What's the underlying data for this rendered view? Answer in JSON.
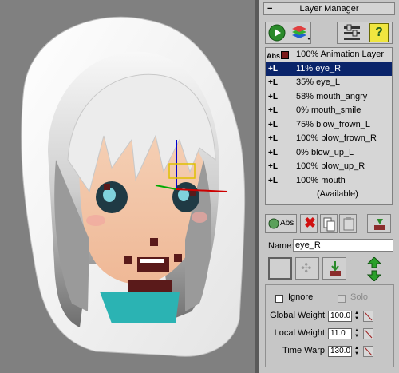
{
  "panel": {
    "title": "Layer Manager",
    "layers": [
      {
        "prefix": "Abs",
        "label": "100% Animation Layer"
      },
      {
        "prefix": "+L",
        "label": "11% eye_R",
        "selected": true
      },
      {
        "prefix": "+L",
        "label": "35% eye_L"
      },
      {
        "prefix": "+L",
        "label": "58% mouth_angry"
      },
      {
        "prefix": "+L",
        "label": "0% mouth_smile"
      },
      {
        "prefix": "+L",
        "label": "75% blow_frown_L"
      },
      {
        "prefix": "+L",
        "label": "100% blow_frown_R"
      },
      {
        "prefix": "+L",
        "label": "0% blow_up_L"
      },
      {
        "prefix": "+L",
        "label": "100% blow_up_R"
      },
      {
        "prefix": "+L",
        "label": "100% mouth"
      },
      {
        "prefix": "",
        "label": "(Available)"
      }
    ],
    "add_abs_label": "Abs",
    "name_label": "Name:",
    "name_value": "eye_R",
    "ignore_label": "Ignore",
    "solo_label": "Solo",
    "global_weight_label": "Global Weight",
    "global_weight_value": "100.0",
    "local_weight_label": "Local Weight",
    "local_weight_value": "11.0",
    "time_warp_label": "Time Warp",
    "time_warp_value": "130.0"
  },
  "icons": {
    "play": "play-icon",
    "layers": "layers-icon",
    "settings": "layer-settings-icon",
    "help": "help-icon",
    "help_glyph": "?"
  },
  "colors": {
    "selection": "#0a246a",
    "panel_bg": "#c6c6c6",
    "viewport_bg": "#808080"
  }
}
